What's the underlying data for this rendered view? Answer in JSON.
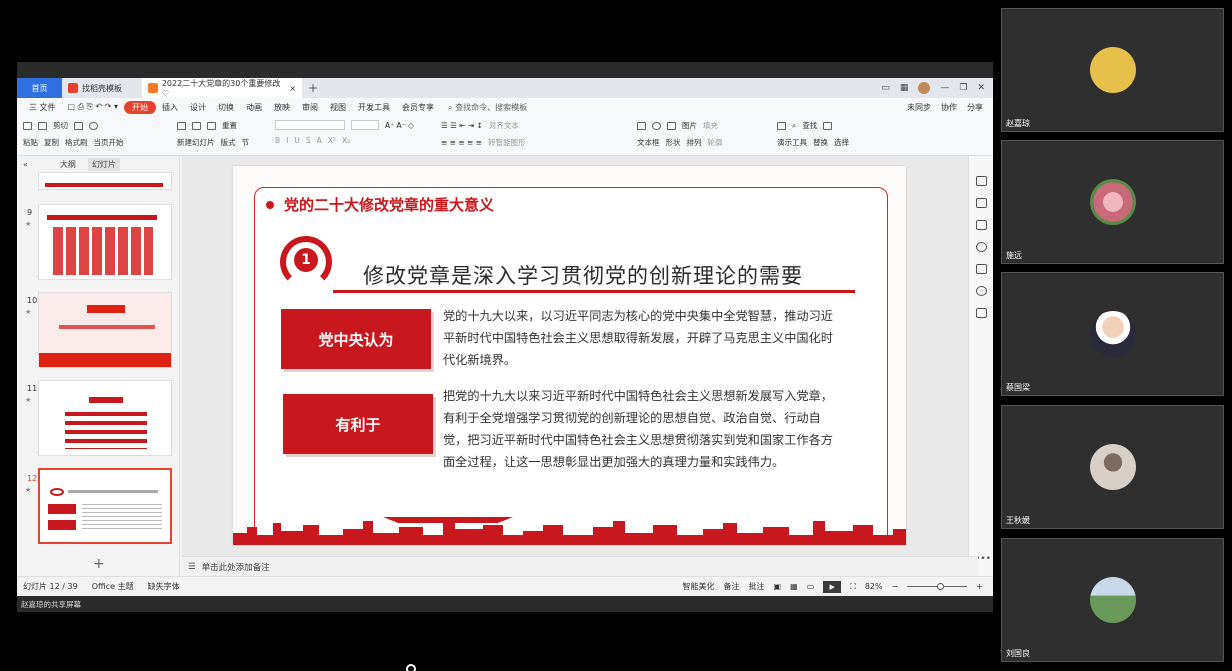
{
  "tabs": {
    "home": "首页",
    "template": "找稻壳模板",
    "document": "2022二十大党章的30个重要修改♡"
  },
  "menu": {
    "file": "三 文件",
    "items": [
      "开始",
      "插入",
      "设计",
      "切换",
      "动画",
      "放映",
      "审阅",
      "视图",
      "开发工具",
      "会员专享"
    ],
    "search": "查找命令、搜索模板",
    "right": [
      "未同步",
      "协作",
      "分享"
    ]
  },
  "ribbon": {
    "paste": "粘贴",
    "cut": "剪切",
    "copy": "复制",
    "format_painter": "格式刷",
    "play_from_current": "当页开始",
    "new_slide": "新建幻灯片",
    "layout": "版式",
    "section": "节",
    "reset": "重置",
    "text_box": "文本框",
    "shape": "形状",
    "arrange": "排列",
    "picture": "图片",
    "fill": "填充",
    "outline": "轮廓",
    "presentation_tool": "演示工具",
    "find": "查找",
    "replace": "替换",
    "select": "选择",
    "align_text": "对齐文本",
    "smart_shape": "转智能图形"
  },
  "left_panel": {
    "tab_outline": "大纲",
    "tab_slides": "幻灯片",
    "slide_numbers": [
      "9",
      "10",
      "11",
      "12"
    ]
  },
  "slide": {
    "heading": "党的二十大修改党章的重大意义",
    "number": "1",
    "subtitle": "修改党章是深入学习贯彻党的创新理论的需要",
    "box1": "党中央认为",
    "para1": "党的十九大以来，以习近平同志为核心的党中央集中全党智慧，推动习近平新时代中国特色社会主义思想取得新发展，开辟了马克思主义中国化时代化新境界。",
    "box2": "有利于",
    "para2": "把党的十九大以来习近平新时代中国特色社会主义思想新发展写入党章，有利于全党增强学习贯彻党的创新理论的思想自觉、政治自觉、行动自觉，把习近平新时代中国特色社会主义思想贯彻落实到党和国家工作各方面全过程，让这一思想彰显出更加强大的真理力量和实践伟力。"
  },
  "notes_placeholder": "单击此处添加备注",
  "status": {
    "slide_count": "幻灯片 12 / 39",
    "theme": "Office 主题",
    "missing_font": "缺失字体",
    "smart_beautify": "智能美化",
    "notes": "备注",
    "comment": "批注",
    "zoom": "82%"
  },
  "share_footer": "赵嘉琼的共享屏幕",
  "participants": [
    {
      "name": "赵嘉琼",
      "color": "#e6c04a"
    },
    {
      "name": "施远",
      "color": "#c86a7a"
    },
    {
      "name": "蔡国梁",
      "color": "#d8d8d8"
    },
    {
      "name": "王秋媛",
      "color": "#b5b5b5"
    },
    {
      "name": "刘国良",
      "color": "#6a9a5a"
    }
  ]
}
